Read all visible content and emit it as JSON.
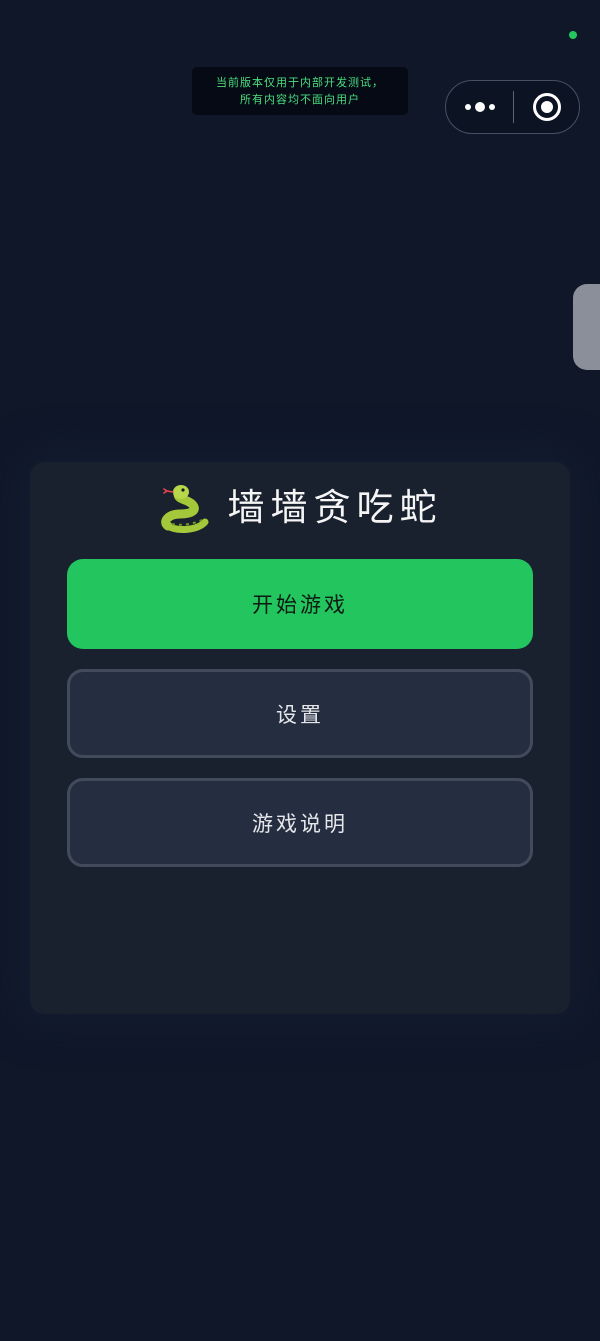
{
  "dev_notice": {
    "line1": "当前版本仅用于内部开发测试，",
    "line2": "所有内容均不面向用户"
  },
  "capsule": {
    "more_icon": "more-dots-icon",
    "close_icon": "target-close-icon"
  },
  "menu": {
    "title_icon": "snake-icon",
    "title": "墙墙贪吃蛇",
    "buttons": {
      "start": "开始游戏",
      "settings": "设置",
      "help": "游戏说明"
    }
  },
  "colors": {
    "background": "#0f1729",
    "panel": "#19202e",
    "primary": "#22c55e",
    "secondary": "#252e40",
    "secondary_border": "#424b5c",
    "notice_text": "#4ade80",
    "status_dot": "#22c55e"
  }
}
